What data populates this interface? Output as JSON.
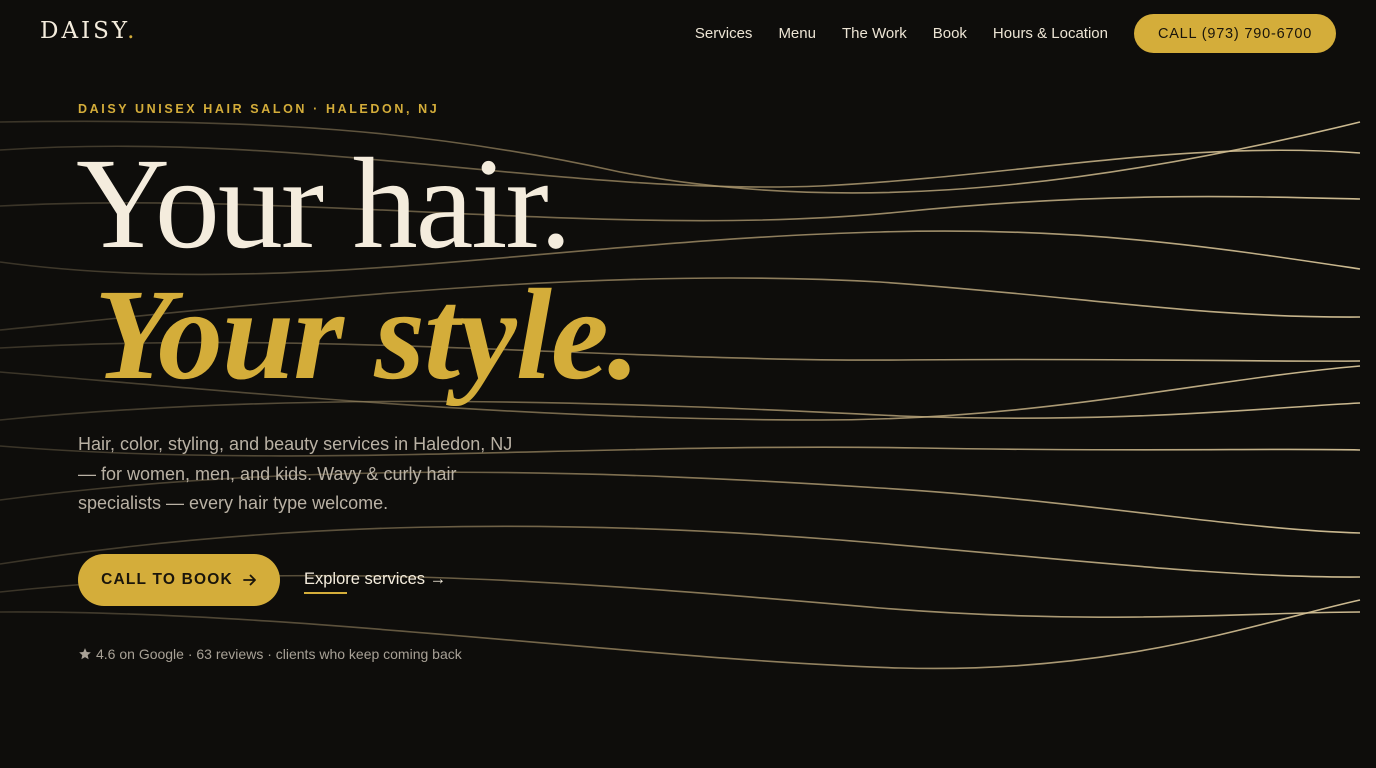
{
  "header": {
    "logo": "DAISY",
    "logo_dot": ".",
    "nav": [
      "Services",
      "Menu",
      "The Work",
      "Book",
      "Hours & Location"
    ],
    "call_button": "CALL (973) 790-6700"
  },
  "hero": {
    "eyebrow": "DAISY UNISEX HAIR SALON · HALEDON, NJ",
    "headline_line1": "Your hair.",
    "headline_line2": "Your style.",
    "lede": "Hair, color, styling, and beauty services in Haledon, NJ — for women, men, and kids. Wavy & curly hair specialists — every hair type welcome.",
    "cta_primary": "CALL TO BOOK",
    "cta_primary_icon": "arrow-right-icon",
    "cta_secondary": "Explore services →",
    "rating_icon": "star-icon",
    "rating_text": "4.6 on Google · 63 reviews · clients who keep coming back"
  },
  "colors": {
    "background": "#0e0d0b",
    "accent": "#d4ad3a",
    "cream": "#f4ecdd",
    "muted_text": "#b9b1a4"
  }
}
